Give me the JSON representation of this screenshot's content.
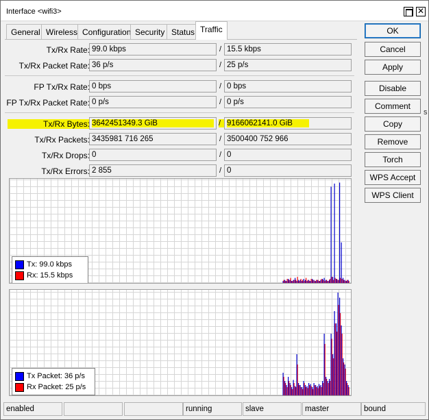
{
  "window": {
    "title": "Interface <wifi3>",
    "maximize_glyph": "",
    "close_glyph": "✕"
  },
  "tabs": [
    "General",
    "Wireless",
    "Configuration",
    "Security",
    "Status",
    "Traffic"
  ],
  "active_tab": "Traffic",
  "rows": {
    "txrx_rate": {
      "label": "Tx/Rx Rate:",
      "tx": "99.0 kbps",
      "rx": "15.5 kbps"
    },
    "txrx_packet_rate": {
      "label": "Tx/Rx Packet Rate:",
      "tx": "36 p/s",
      "rx": "25 p/s"
    },
    "fp_txrx_rate": {
      "label": "FP Tx/Rx Rate:",
      "tx": "0 bps",
      "rx": "0 bps"
    },
    "fp_txrx_packet_rate": {
      "label": "FP Tx/Rx Packet Rate:",
      "tx": "0 p/s",
      "rx": "0 p/s"
    },
    "txrx_bytes": {
      "label": "Tx/Rx Bytes:",
      "tx": "3642451349.3 GiB",
      "rx": "9166062141.0 GiB"
    },
    "txrx_packets": {
      "label": "Tx/Rx Packets:",
      "tx": "3435981 716 265",
      "rx": "3500400 752 966"
    },
    "txrx_drops": {
      "label": "Tx/Rx Drops:",
      "tx": "0",
      "rx": "0"
    },
    "txrx_errors": {
      "label": "Tx/Rx Errors:",
      "tx": "2 855",
      "rx": "0"
    }
  },
  "slash": "/",
  "graph_bytes": {
    "legend": [
      {
        "label": "Tx:  99.0 kbps",
        "color": "#0000ff"
      },
      {
        "label": "Rx:  15.5 kbps",
        "color": "#ff0000"
      }
    ],
    "tx": [
      2,
      3,
      2,
      4,
      3,
      2,
      3,
      5,
      2,
      3,
      3,
      2,
      4,
      3,
      2,
      3,
      2,
      4,
      3,
      2,
      3,
      2,
      3,
      4,
      5,
      3,
      2,
      3,
      95,
      6,
      98,
      4,
      3,
      99,
      40,
      5,
      3,
      2,
      3
    ],
    "rx": [
      3,
      2,
      4,
      3,
      5,
      2,
      3,
      3,
      6,
      2,
      4,
      3,
      2,
      5,
      3,
      2,
      4,
      3,
      2,
      3,
      3,
      2,
      4,
      3,
      2,
      3,
      2,
      4,
      6,
      3,
      5,
      4,
      3,
      5,
      4,
      3,
      2,
      3,
      2
    ]
  },
  "graph_packets": {
    "legend": [
      {
        "label": "Tx Packet:  36 p/s",
        "color": "#0000ff"
      },
      {
        "label": "Rx Packet:  25 p/s",
        "color": "#ff0000"
      }
    ],
    "tx": [
      22,
      14,
      10,
      18,
      12,
      8,
      15,
      9,
      40,
      12,
      10,
      8,
      14,
      10,
      9,
      12,
      11,
      8,
      12,
      10,
      9,
      11,
      10,
      14,
      60,
      18,
      14,
      16,
      60,
      40,
      82,
      70,
      100,
      95,
      68,
      36,
      30,
      14,
      10
    ],
    "rx": [
      18,
      12,
      8,
      14,
      10,
      6,
      12,
      8,
      30,
      10,
      8,
      6,
      12,
      8,
      7,
      10,
      9,
      6,
      10,
      8,
      7,
      9,
      8,
      12,
      50,
      16,
      12,
      14,
      55,
      36,
      70,
      62,
      88,
      80,
      60,
      32,
      26,
      12,
      8
    ]
  },
  "buttons": [
    "OK",
    "Cancel",
    "Apply",
    "Disable",
    "Comment",
    "Copy",
    "Remove",
    "Torch",
    "WPS Accept",
    "WPS Client"
  ],
  "status": [
    "enabled",
    "",
    "",
    "running",
    "slave",
    "master",
    "bound"
  ],
  "background": {
    "right_glyph": "s"
  }
}
